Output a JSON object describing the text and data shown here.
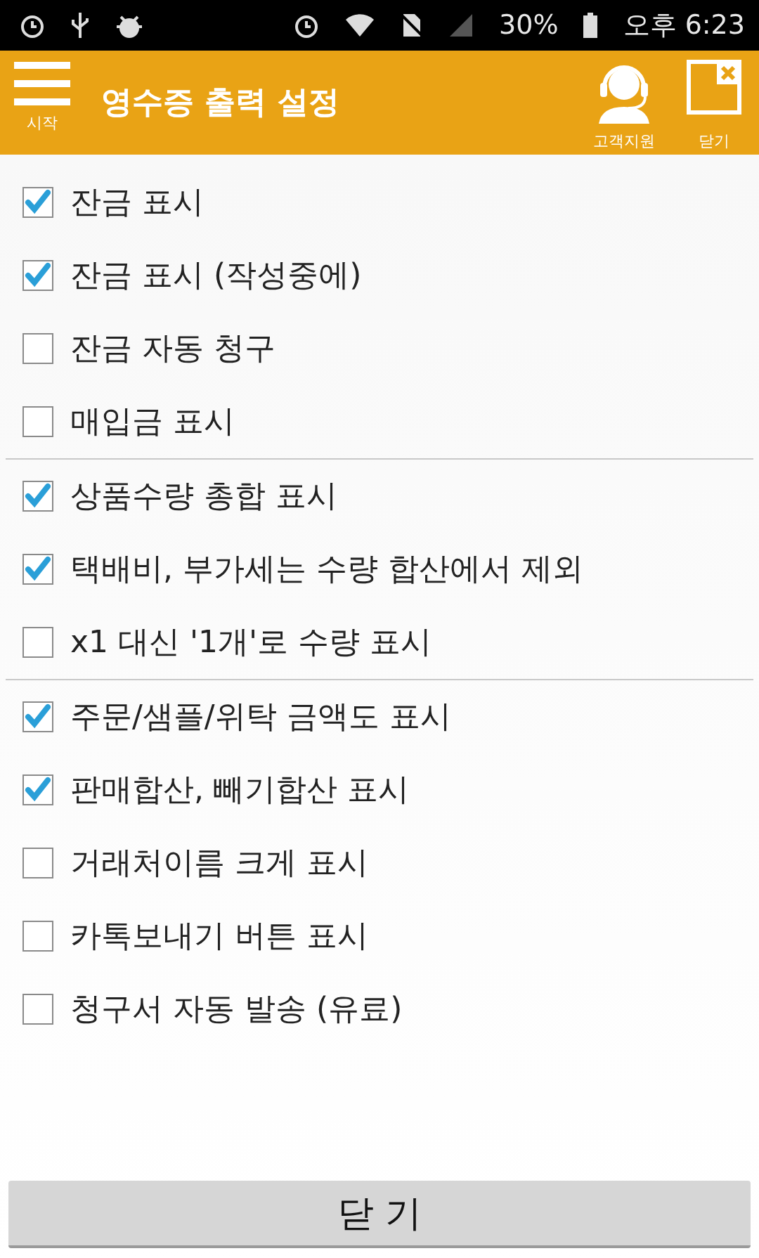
{
  "status_bar": {
    "battery": "30%",
    "time": "오후 6:23"
  },
  "header": {
    "menu_label": "시작",
    "title": "영수증 출력 설정",
    "actions": [
      {
        "kind": "support",
        "label": "고객지원"
      },
      {
        "kind": "close",
        "label": "닫기"
      }
    ]
  },
  "groups": [
    [
      {
        "label": "잔금 표시",
        "checked": true
      },
      {
        "label": "잔금 표시 (작성중에)",
        "checked": true
      },
      {
        "label": "잔금 자동 청구",
        "checked": false
      },
      {
        "label": "매입금 표시",
        "checked": false
      }
    ],
    [
      {
        "label": "상품수량 총합 표시",
        "checked": true
      },
      {
        "label": "택배비, 부가세는 수량 합산에서 제외",
        "checked": true
      },
      {
        "label": "x1 대신 '1개'로 수량 표시",
        "checked": false
      }
    ],
    [
      {
        "label": "주문/샘플/위탁 금액도 표시",
        "checked": true
      },
      {
        "label": "판매합산, 빼기합산 표시",
        "checked": true
      },
      {
        "label": "거래처이름 크게 표시",
        "checked": false
      },
      {
        "label": "카톡보내기 버튼 표시",
        "checked": false
      },
      {
        "label": "청구서 자동 발송 (유료)",
        "checked": false
      }
    ]
  ],
  "close_button": "닫 기"
}
